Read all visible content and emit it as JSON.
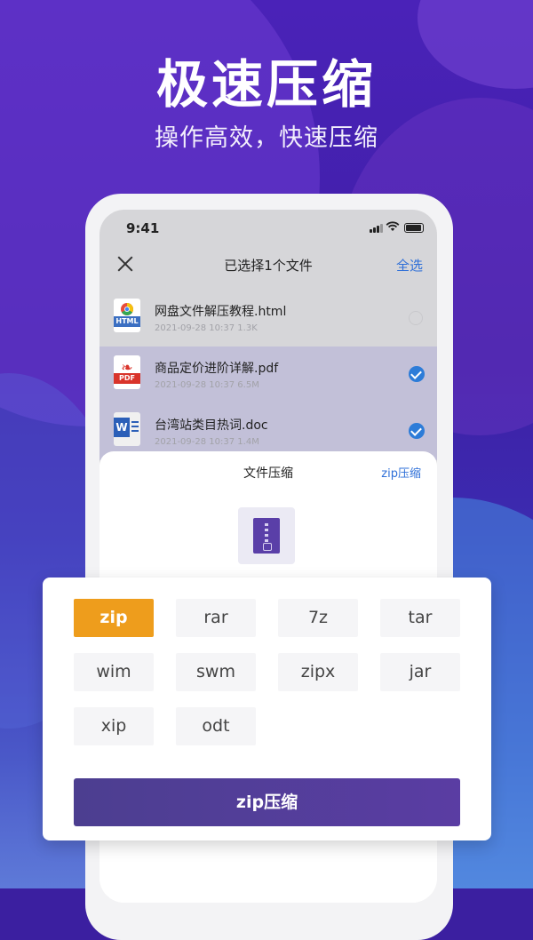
{
  "promo": {
    "headline": "极速压缩",
    "subline": "操作高效，快速压缩"
  },
  "status_bar": {
    "time": "9:41"
  },
  "navbar": {
    "title": "已选择1个文件",
    "select_all": "全选"
  },
  "files": [
    {
      "name": "网盘文件解压教程.html",
      "meta": "2021-09-28 10:37   1.3K",
      "type_tag": "HTML",
      "selected": false
    },
    {
      "name": "商品定价进阶详解.pdf",
      "meta": "2021-09-28 10:37   6.5M",
      "type_tag": "PDF",
      "selected": true
    },
    {
      "name": "台湾站类目热词.doc",
      "meta": "2021-09-28 10:37   1.4M",
      "type_tag": "W",
      "selected": true
    }
  ],
  "sheet": {
    "title": "文件压缩",
    "current_format": "zip压缩"
  },
  "formats": [
    "zip",
    "rar",
    "7z",
    "tar",
    "wim",
    "swm",
    "zipx",
    "jar",
    "xip",
    "odt"
  ],
  "selected_format": "zip",
  "action_button": "zip压缩",
  "colors": {
    "accent_orange": "#ee9d1c",
    "accent_blue": "#2d7cd8",
    "button_purple": "#4c3e90"
  }
}
